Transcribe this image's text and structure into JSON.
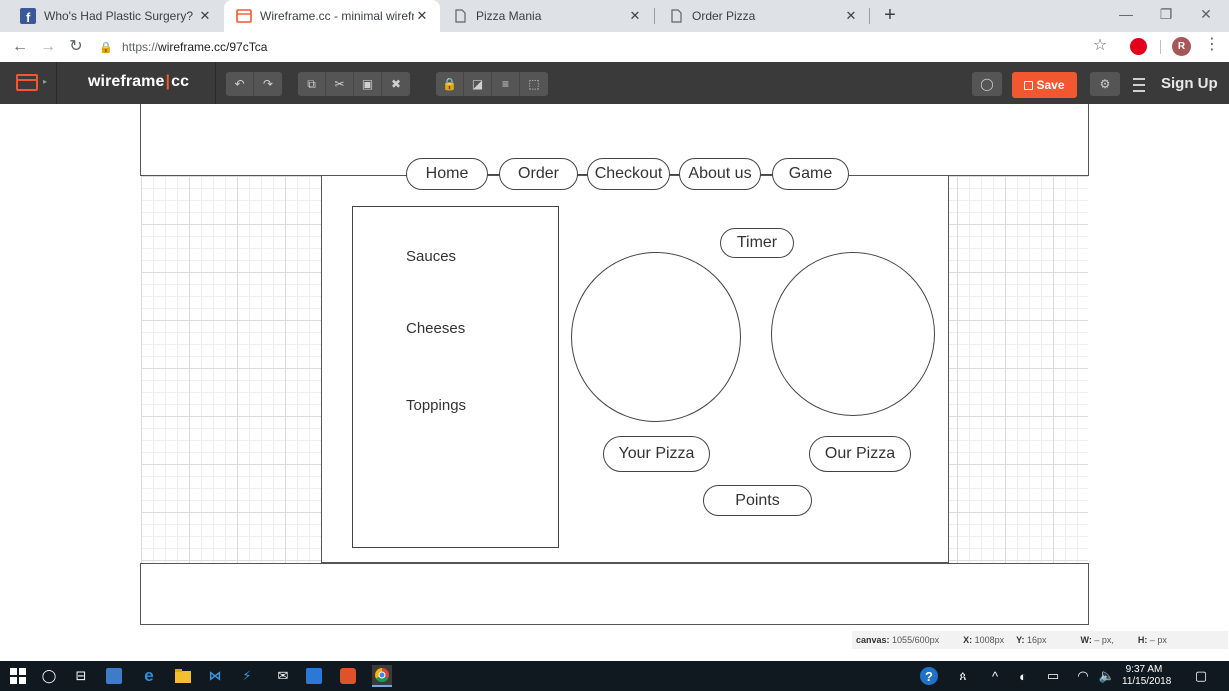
{
  "browser": {
    "tabs": [
      {
        "title": "Who's Had Plastic Surgery? (Kirb",
        "favicon": "facebook-icon",
        "active": false
      },
      {
        "title": "Wireframe.cc - minimal wirefram",
        "favicon": "wireframe-icon",
        "active": true
      },
      {
        "title": "Pizza Mania",
        "favicon": "page-icon",
        "active": false
      },
      {
        "title": "Order Pizza",
        "favicon": "page-icon",
        "active": false
      }
    ],
    "url_prefix": "https://",
    "url_rest": "wireframe.cc/97cTca",
    "profile_initial": "R"
  },
  "app": {
    "brand_left": "wireframe",
    "brand_pipe": "|",
    "brand_right": "cc",
    "save_label": "Save",
    "signup_label": "Sign Up",
    "accent_color": "#f1582f"
  },
  "wireframe": {
    "nav": [
      "Home",
      "Order",
      "Checkout",
      "About us",
      "Game"
    ],
    "sidebar": [
      "Sauces",
      "Cheeses",
      "Toppings"
    ],
    "timer": "Timer",
    "your_pizza": "Your Pizza",
    "our_pizza": "Our Pizza",
    "points": "Points"
  },
  "status": {
    "canvas_label": "canvas:",
    "canvas_value": "1055/600px",
    "x_label": "X:",
    "x_value": "1008px",
    "y_label": "Y:",
    "y_value": "16px",
    "w_label": "W:",
    "w_value": "– px,",
    "h_label": "H:",
    "h_value": "– px"
  },
  "taskbar": {
    "time": "9:37 AM",
    "date": "11/15/2018"
  }
}
